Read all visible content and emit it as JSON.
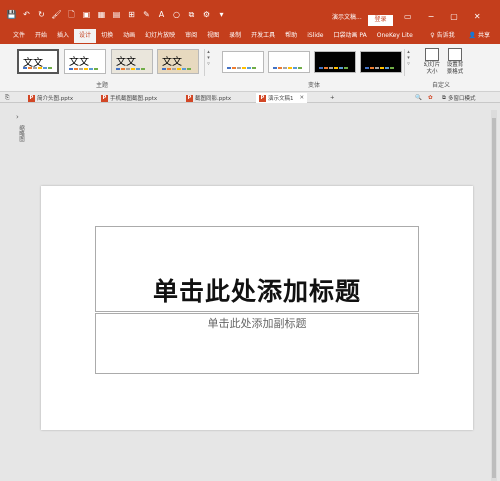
{
  "window": {
    "doc_title": "演示文稿...",
    "login_label": "登录",
    "controls": [
      "▭",
      "−",
      "▢",
      "✕"
    ]
  },
  "qat": [
    {
      "name": "save-icon",
      "glyph": "💾"
    },
    {
      "name": "undo-icon",
      "glyph": "↶"
    },
    {
      "name": "redo-icon",
      "glyph": "↻"
    },
    {
      "name": "format-painter-icon",
      "glyph": "🖌"
    },
    {
      "name": "new-doc-icon",
      "glyph": "🗋"
    },
    {
      "name": "picture-icon",
      "glyph": "▣"
    },
    {
      "name": "table-icon",
      "glyph": "▦"
    },
    {
      "name": "layout-icon",
      "glyph": "▤"
    },
    {
      "name": "insert-icon",
      "glyph": "⊞"
    },
    {
      "name": "pen-icon",
      "glyph": "✎"
    },
    {
      "name": "font-color-icon",
      "glyph": "A"
    },
    {
      "name": "shape-icon",
      "glyph": "○"
    },
    {
      "name": "group-icon",
      "glyph": "⧉"
    },
    {
      "name": "gear-icon",
      "glyph": "⚙"
    },
    {
      "name": "more-icon",
      "glyph": "▾"
    }
  ],
  "menu": {
    "items": [
      "文件",
      "开始",
      "插入",
      "设计",
      "切换",
      "动画",
      "幻灯片放映",
      "审阅",
      "视图",
      "录制",
      "开发工具",
      "帮助",
      "iSlide",
      "口袋动画 PA",
      "OneKey Lite"
    ],
    "active_index": 3,
    "tell_me": "告诉我",
    "share": "共享"
  },
  "ribbon": {
    "themes_label": "主题",
    "variants_label": "变体",
    "customize_label": "自定义",
    "theme_sample": "文文",
    "slide_size_label": "幻灯片\n大小",
    "format_bg_label": "设置背\n景格式",
    "theme_colors": [
      "#4472c4",
      "#ed7d31",
      "#a5a5a5",
      "#ffc000",
      "#5b9bd5",
      "#70ad47"
    ],
    "variant_backgrounds": [
      "#ffffff",
      "#ffffff",
      "#000000",
      "#000000"
    ]
  },
  "tabs": {
    "items": [
      {
        "label": "简介头图.pptx"
      },
      {
        "label": "手机截图截图.pptx"
      },
      {
        "label": "截图同影.pptx"
      },
      {
        "label": "演示文稿1"
      }
    ],
    "add_label": "+",
    "multi_window": "多窗口模式"
  },
  "left_pane": {
    "label": "缩略图"
  },
  "slide": {
    "title": "单击此处添加标题",
    "subtitle": "单击此处添加副标题"
  }
}
